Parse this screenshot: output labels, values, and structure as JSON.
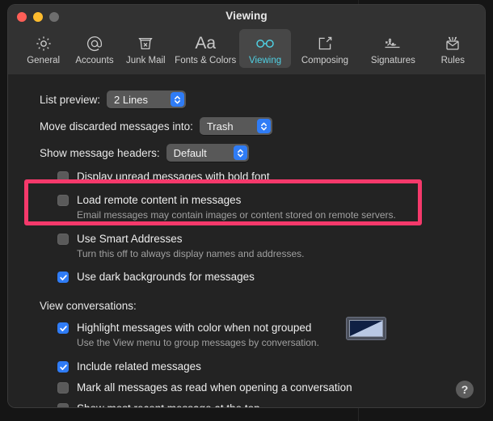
{
  "window": {
    "title": "Viewing",
    "traffic_lights": [
      {
        "name": "close",
        "color": "#ff5f57"
      },
      {
        "name": "minimize",
        "color": "#febc2e"
      },
      {
        "name": "zoom",
        "color": "#6e6e6e"
      }
    ]
  },
  "toolbar": {
    "tabs": [
      {
        "label": "General",
        "icon": "gear-icon"
      },
      {
        "label": "Accounts",
        "icon": "at-sign-icon"
      },
      {
        "label": "Junk Mail",
        "icon": "trash-x-icon"
      },
      {
        "label": "Fonts & Colors",
        "icon": "aa-icon"
      },
      {
        "label": "Viewing",
        "icon": "eyeglasses-icon",
        "selected": true
      },
      {
        "label": "Composing",
        "icon": "compose-pencil-icon"
      },
      {
        "label": "Signatures",
        "icon": "signature-icon"
      },
      {
        "label": "Rules",
        "icon": "envelope-arrows-icon"
      }
    ],
    "selected_accent": "#4fd0e3"
  },
  "settings": {
    "popups": [
      {
        "label": "List preview:",
        "value": "2 Lines"
      },
      {
        "label": "Move discarded messages into:",
        "value": "Trash"
      },
      {
        "label": "Show message headers:",
        "value": "Default"
      }
    ],
    "checkboxes": [
      {
        "title": "Display unread messages with bold font",
        "checked": false,
        "sub": ""
      },
      {
        "title": "Load remote content in messages",
        "checked": false,
        "sub": "Email messages may contain images or content stored on remote servers."
      },
      {
        "title": "Use Smart Addresses",
        "checked": false,
        "sub": "Turn this off to always display names and addresses."
      },
      {
        "title": "Use dark backgrounds for messages",
        "checked": true,
        "sub": ""
      }
    ],
    "conversations_label": "View conversations:",
    "conversation_checkboxes": [
      {
        "title": "Highlight messages with color when not grouped",
        "checked": true,
        "sub": "Use the View menu to group messages by conversation."
      },
      {
        "title": "Include related messages",
        "checked": true,
        "sub": ""
      },
      {
        "title": "Mark all messages as read when opening a conversation",
        "checked": false,
        "sub": ""
      },
      {
        "title": "Show most recent message at the top",
        "checked": false,
        "sub": ""
      }
    ],
    "color_well": {
      "name": "highlight-color-well",
      "dark_color": "#0f2044",
      "light_color": "#b9c8e4"
    }
  },
  "help_button": {
    "label": "?"
  },
  "annotation": {
    "color": "#f5396b",
    "targets": "Load remote content in messages"
  }
}
